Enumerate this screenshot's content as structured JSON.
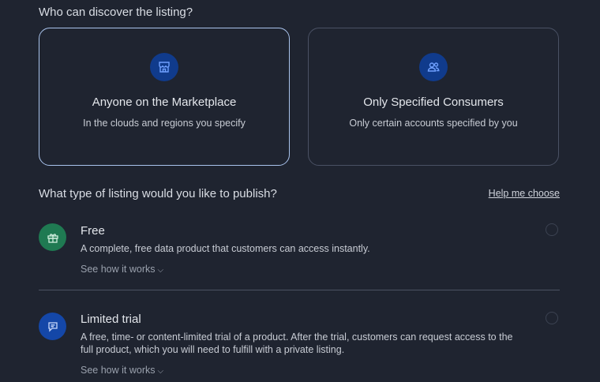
{
  "discover": {
    "question": "Who can discover the listing?",
    "options": [
      {
        "title": "Anyone on the Marketplace",
        "desc": "In the clouds and regions you specify",
        "icon": "storefront-icon",
        "selected": true
      },
      {
        "title": "Only Specified Consumers",
        "desc": "Only certain accounts specified by you",
        "icon": "users-icon",
        "selected": false
      }
    ]
  },
  "listing_type": {
    "question": "What type of listing would you like to publish?",
    "help_link": "Help me choose",
    "options": [
      {
        "title": "Free",
        "desc": "A complete, free data product that customers can access instantly.",
        "how": "See how it works",
        "icon": "gift-icon",
        "icon_color": "#1f7a52"
      },
      {
        "title": "Limited trial",
        "desc": "A free, time- or content-limited trial of a product. After the trial, customers can request access to the full product, which you will need to fulfill with a private listing.",
        "how": "See how it works",
        "icon": "chat-icon",
        "icon_color": "#1447a8"
      }
    ]
  },
  "colors": {
    "background": "#1f2430",
    "accent": "#103b8c",
    "selected_border": "#a9c3ec"
  }
}
